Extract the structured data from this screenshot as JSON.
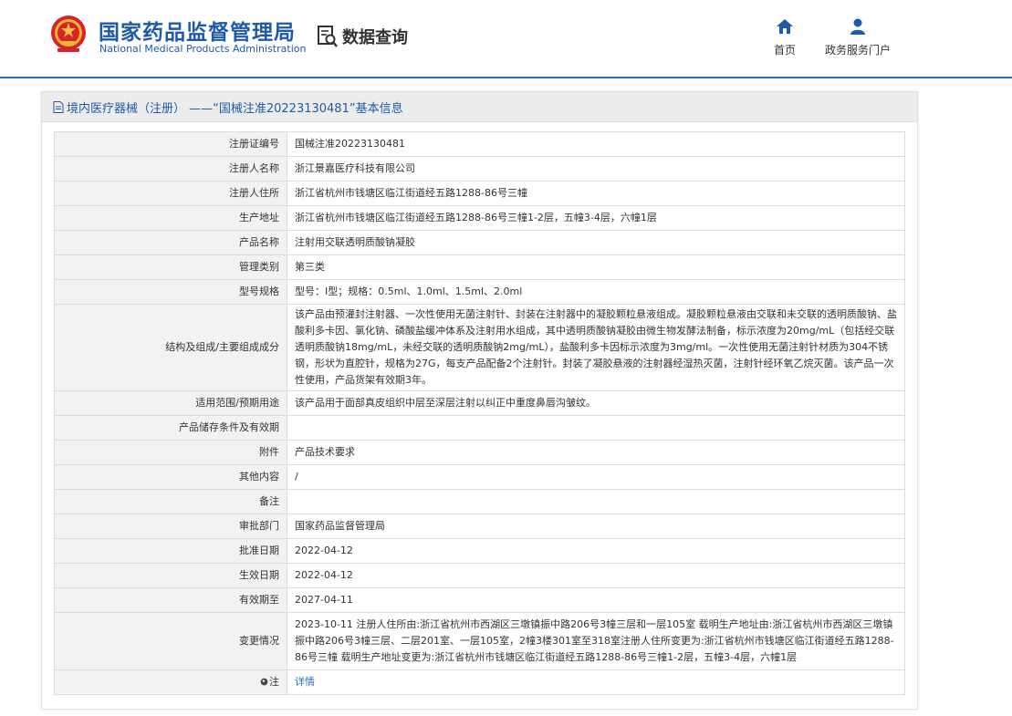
{
  "header": {
    "brand_cn": "国家药品监督管理局",
    "brand_en": "National Medical Products Administration",
    "query_label": "数据查询",
    "nav": [
      {
        "label": "首页",
        "icon": "home-icon"
      },
      {
        "label": "政务服务门户",
        "icon": "user-icon"
      }
    ],
    "accent_color": "#1f5aa8",
    "emblem_icon": "national-emblem-icon"
  },
  "panel": {
    "title": "境内医疗器械（注册） ——“国械注准20223130481”基本信息",
    "icon": "document-icon"
  },
  "rows": [
    {
      "label": "注册证编号",
      "value": "国械注准20223130481"
    },
    {
      "label": "注册人名称",
      "value": "浙江景嘉医疗科技有限公司"
    },
    {
      "label": "注册人住所",
      "value": "浙江省杭州市钱塘区临江街道经五路1288-86号三幢"
    },
    {
      "label": "生产地址",
      "value": "浙江省杭州市钱塘区临江街道经五路1288-86号三幢1-2层，五幢3-4层，六幢1层"
    },
    {
      "label": "产品名称",
      "value": "注射用交联透明质酸钠凝胶"
    },
    {
      "label": "管理类别",
      "value": "第三类"
    },
    {
      "label": "型号规格",
      "value": "型号：Ⅰ型；规格：0.5ml、1.0ml、1.5ml、2.0ml"
    },
    {
      "label": "结构及组成/主要组成成分",
      "value": "该产品由预灌封注射器、一次性使用无菌注射针、封装在注射器中的凝胶颗粒悬液组成。凝胶颗粒悬液由交联和未交联的透明质酸钠、盐酸利多卡因、氯化钠、磷酸盐缓冲体系及注射用水组成，其中透明质酸钠凝胶由微生物发酵法制备，标示浓度为20mg/mL（包括经交联透明质酸钠18mg/mL，未经交联的透明质酸钠2mg/mL），盐酸利多卡因标示浓度为3mg/ml。一次性使用无菌注射针材质为304不锈钢，形状为直腔针，规格为27G，每支产品配备2个注射针。封装了凝胶悬液的注射器经湿热灭菌，注射针经环氧乙烷灭菌。该产品一次性使用，产品货架有效期3年。"
    },
    {
      "label": "适用范围/预期用途",
      "value": "该产品用于面部真皮组织中层至深层注射以纠正中重度鼻唇沟皱纹。"
    },
    {
      "label": "产品储存条件及有效期",
      "value": ""
    },
    {
      "label": "附件",
      "value": "产品技术要求"
    },
    {
      "label": "其他内容",
      "value": "/"
    },
    {
      "label": "备注",
      "value": ""
    },
    {
      "label": "审批部门",
      "value": "国家药品监督管理局"
    },
    {
      "label": "批准日期",
      "value": "2022-04-12"
    },
    {
      "label": "生效日期",
      "value": "2022-04-12"
    },
    {
      "label": "有效期至",
      "value": "2027-04-11"
    },
    {
      "label": "变更情况",
      "value": "2023-10-11 注册人住所由:浙江省杭州市西湖区三墩镇振中路206号3幢三层和一层105室 载明生产地址由:浙江省杭州市西湖区三墩镇振中路206号3幢三层、二层201室、一层105室，2幢3楼301室至318室注册人住所变更为:浙江省杭州市钱塘区临江街道经五路1288-86号三幢 载明生产地址变更为:浙江省杭州市钱塘区临江街道经五路1288-86号三幢1-2层，五幢3-4层，六幢1层"
    },
    {
      "label": "注",
      "value": "详情",
      "label_icon": "globe-icon"
    }
  ]
}
